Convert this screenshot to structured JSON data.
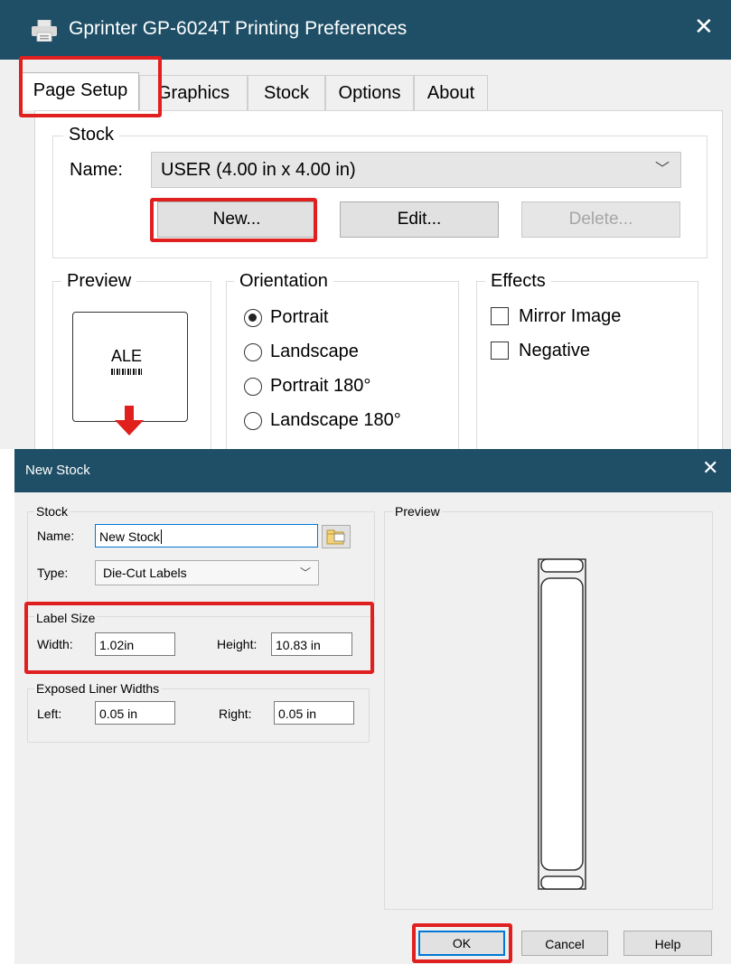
{
  "printing_preferences": {
    "title": "Gprinter GP-6024T Printing Preferences",
    "tabs": [
      {
        "label": "Page Setup",
        "active": true
      },
      {
        "label": "Graphics",
        "active": false
      },
      {
        "label": "Stock",
        "active": false
      },
      {
        "label": "Options",
        "active": false
      },
      {
        "label": "About",
        "active": false
      }
    ],
    "stock": {
      "group_label": "Stock",
      "name_label": "Name:",
      "name_value": "USER (4.00 in x 4.00 in)",
      "new_button": "New...",
      "edit_button": "Edit...",
      "delete_button": "Delete..."
    },
    "preview": {
      "group_label": "Preview",
      "sample_text": "ALE"
    },
    "orientation": {
      "group_label": "Orientation",
      "options": [
        "Portrait",
        "Landscape",
        "Portrait 180°",
        "Landscape 180°"
      ],
      "selected": "Portrait"
    },
    "effects": {
      "group_label": "Effects",
      "options": [
        {
          "label": "Mirror Image",
          "checked": false
        },
        {
          "label": "Negative",
          "checked": false
        }
      ]
    }
  },
  "new_stock": {
    "title": "New Stock",
    "stock_group": {
      "label": "Stock",
      "name_label": "Name:",
      "name_value": "New Stock",
      "type_label": "Type:",
      "type_value": "Die-Cut Labels"
    },
    "label_size": {
      "label": "Label Size",
      "width_label": "Width:",
      "width_value": "1.02in",
      "height_label": "Height:",
      "height_value": "10.83 in"
    },
    "liner": {
      "label": "Exposed Liner Widths",
      "left_label": "Left:",
      "left_value": "0.05 in",
      "right_label": "Right:",
      "right_value": "0.05 in"
    },
    "preview_label": "Preview",
    "buttons": {
      "ok": "OK",
      "cancel": "Cancel",
      "help": "Help"
    }
  },
  "colors": {
    "title_bar": "#1f4f66",
    "highlight": "#e02020",
    "focus": "#0078d7"
  }
}
